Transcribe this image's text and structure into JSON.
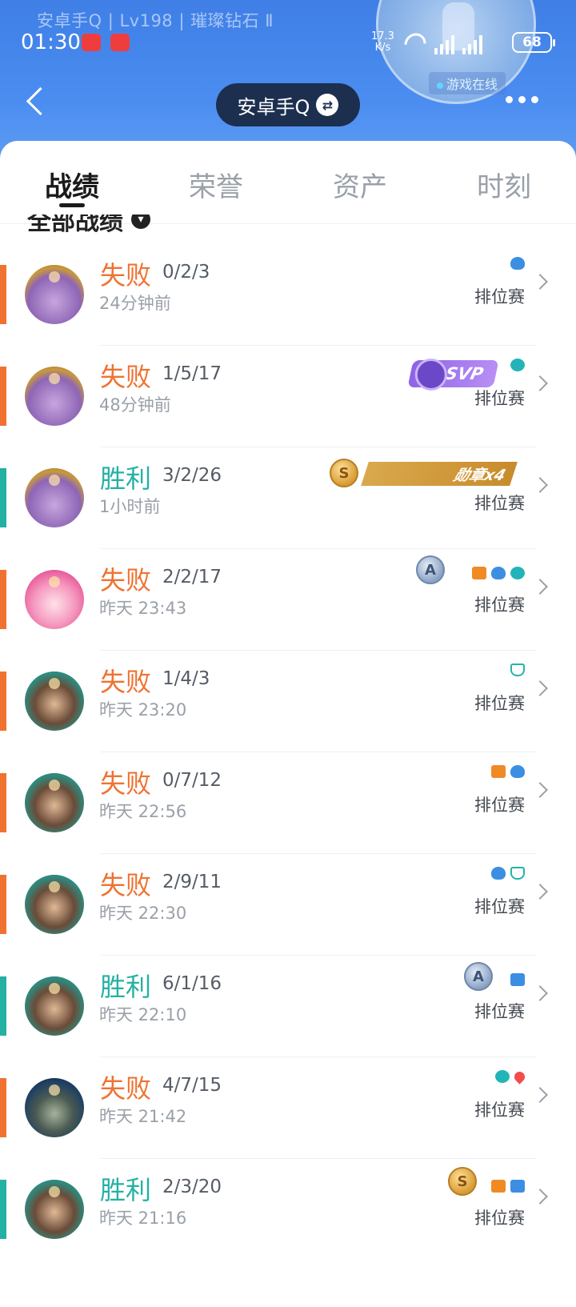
{
  "status_bar": {
    "profile_line": "安卓手Q | Lv198 | 璀璨钻石 Ⅱ",
    "time": "01:30",
    "net_speed_value": "17.3",
    "net_speed_unit": "K/s",
    "battery": "68"
  },
  "header": {
    "online_status": "游戏在线",
    "account_name": "安卓手Q"
  },
  "tabs": [
    {
      "label": "战绩",
      "active": true
    },
    {
      "label": "荣誉",
      "active": false
    },
    {
      "label": "资产",
      "active": false
    },
    {
      "label": "时刻",
      "active": false
    }
  ],
  "section": {
    "title": "全部战绩"
  },
  "matches": [
    {
      "result": "失败",
      "kda": "0/2/3",
      "time": "24分钟前",
      "mode": "排位赛",
      "outcome": "loss",
      "hero_avatar": "purple-hero",
      "medals": [
        "blue-tree-icon"
      ]
    },
    {
      "result": "失败",
      "kda": "1/5/17",
      "time": "48分钟前",
      "mode": "排位赛",
      "outcome": "loss",
      "hero_avatar": "purple-hero",
      "badge": "SVP",
      "medals": [
        "teal-heart-icon"
      ]
    },
    {
      "result": "胜利",
      "kda": "3/2/26",
      "time": "1小时前",
      "mode": "排位赛",
      "outcome": "win",
      "hero_avatar": "purple-hero",
      "coin": "S",
      "medal_bar": "勋章x4",
      "medals": []
    },
    {
      "result": "失败",
      "kda": "2/2/17",
      "time": "昨天 23:43",
      "mode": "排位赛",
      "outcome": "loss",
      "hero_avatar": "pink-hero",
      "coin_silver": "A",
      "medals": [
        "orange-flag-icon",
        "blue-tree-icon",
        "teal-heart-icon"
      ]
    },
    {
      "result": "失败",
      "kda": "1/4/3",
      "time": "昨天 23:20",
      "mode": "排位赛",
      "outcome": "loss",
      "hero_avatar": "teal-hero",
      "medals": [
        "teal-shield-icon"
      ]
    },
    {
      "result": "失败",
      "kda": "0/7/12",
      "time": "昨天 22:56",
      "mode": "排位赛",
      "outcome": "loss",
      "hero_avatar": "teal-hero",
      "medals": [
        "orange-flag-icon",
        "blue-tree-icon"
      ]
    },
    {
      "result": "失败",
      "kda": "2/9/11",
      "time": "昨天 22:30",
      "mode": "排位赛",
      "outcome": "loss",
      "hero_avatar": "teal-hero",
      "medals": [
        "blue-tree-icon",
        "teal-shield-icon"
      ]
    },
    {
      "result": "胜利",
      "kda": "6/1/16",
      "time": "昨天 22:10",
      "mode": "排位赛",
      "outcome": "win",
      "hero_avatar": "teal-hero",
      "coin_silver": "A",
      "medals": [
        "blue-tower-icon"
      ]
    },
    {
      "result": "失败",
      "kda": "4/7/15",
      "time": "昨天 21:42",
      "mode": "排位赛",
      "outcome": "loss",
      "hero_avatar": "dark-hero",
      "medals": [
        "teal-heart-icon",
        "red-drop-icon"
      ]
    },
    {
      "result": "胜利",
      "kda": "2/3/20",
      "time": "昨天 21:16",
      "mode": "排位赛",
      "outcome": "win",
      "hero_avatar": "teal-hero",
      "coin": "S",
      "medals": [
        "orange-flag-icon",
        "blue-box-icon"
      ]
    }
  ],
  "colors": {
    "header_blue": "#4a8cf0",
    "loss": "#ef7231",
    "win": "#24b1a4",
    "svp_purple": "#8d63e8",
    "medal_gold": "#d9a94d"
  }
}
